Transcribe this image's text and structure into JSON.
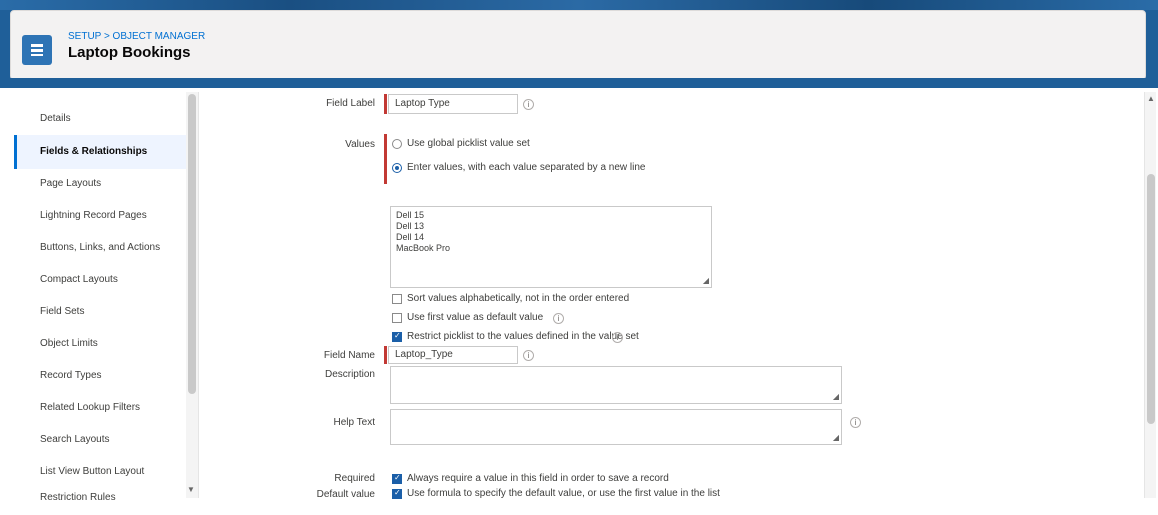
{
  "header": {
    "breadcrumb_prefix": "SETUP > OBJECT MANAGER",
    "title": "Laptop Bookings"
  },
  "sidebar": {
    "items": [
      {
        "label": "Details"
      },
      {
        "label": "Fields & Relationships"
      },
      {
        "label": "Page Layouts"
      },
      {
        "label": "Lightning Record Pages"
      },
      {
        "label": "Buttons, Links, and Actions"
      },
      {
        "label": "Compact Layouts"
      },
      {
        "label": "Field Sets"
      },
      {
        "label": "Object Limits"
      },
      {
        "label": "Record Types"
      },
      {
        "label": "Related Lookup Filters"
      },
      {
        "label": "Search Layouts"
      },
      {
        "label": "List View Button Layout"
      },
      {
        "label": "Restriction Rules"
      }
    ]
  },
  "form": {
    "field_label": {
      "label": "Field Label",
      "value": "Laptop Type"
    },
    "values": {
      "label": "Values",
      "option_global": "Use global picklist value set",
      "option_enter": "Enter values, with each value separated by a new line",
      "entries": [
        "Dell 15",
        "Dell 13",
        "Dell 14",
        "MacBook Pro"
      ],
      "cb_alpha": "Sort values alphabetically, not in the order entered",
      "cb_default": "Use first value as default value",
      "cb_restrict": "Restrict picklist to the values defined in the value set"
    },
    "field_name": {
      "label": "Field Name",
      "value": "Laptop_Type"
    },
    "description": {
      "label": "Description",
      "value": ""
    },
    "help_text": {
      "label": "Help Text",
      "value": ""
    },
    "required": {
      "label": "Required",
      "text": "Always require a value in this field in order to save a record"
    },
    "default_value": {
      "label": "Default value",
      "text": "Use formula to specify the default value, or use the first value in the list"
    }
  },
  "colors": {
    "brand": "#1f5f99",
    "accent": "#0070d2",
    "required": "#c23934"
  }
}
